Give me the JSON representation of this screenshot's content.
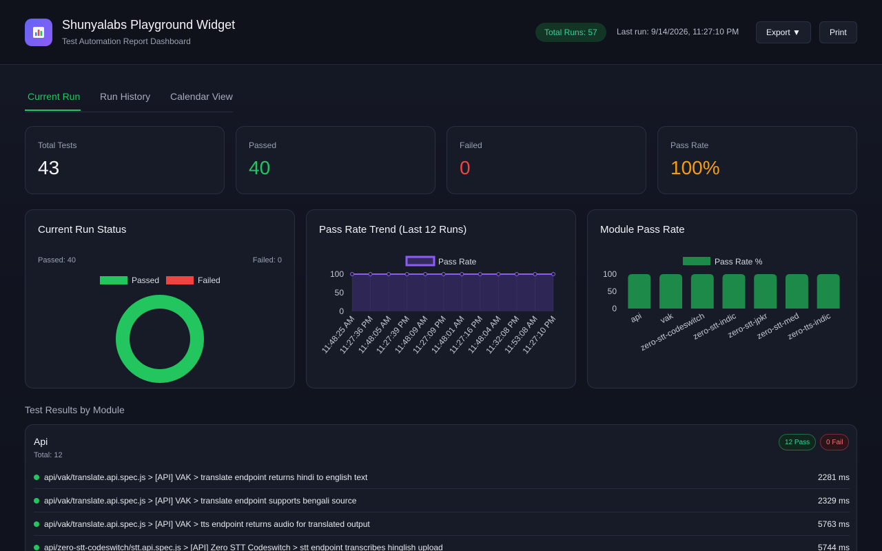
{
  "header": {
    "title": "Shunyalabs Playground Widget",
    "subtitle": "Test Automation Report Dashboard",
    "logo_icon": "bar-chart-icon",
    "total_runs": "Total Runs: 57",
    "last_run": "Last run: 9/14/2026, 11:27:10 PM",
    "export_label": "Export ▼",
    "print_label": "Print"
  },
  "tabs": [
    {
      "label": "Current Run",
      "active": true
    },
    {
      "label": "Run History",
      "active": false
    },
    {
      "label": "Calendar View",
      "active": false
    }
  ],
  "stats": [
    {
      "label": "Total Tests",
      "value": "43",
      "color": "#f3f4f8"
    },
    {
      "label": "Passed",
      "value": "40",
      "color": "#22c55e"
    },
    {
      "label": "Failed",
      "value": "0",
      "color": "#ef4444"
    },
    {
      "label": "Pass Rate",
      "value": "100%",
      "color": "#f59e0b"
    }
  ],
  "chart_data": [
    {
      "type": "pie",
      "title": "Current Run Status",
      "passed_label": "Passed: 40",
      "failed_label": "Failed: 0",
      "categories": [
        "Passed",
        "Failed"
      ],
      "values": [
        40,
        0
      ],
      "colors": [
        "#22c55e",
        "#ef4444"
      ],
      "legend": "top"
    },
    {
      "type": "area",
      "title": "Pass Rate Trend (Last 12 Runs)",
      "categories": [
        "11:48:25 AM",
        "11:27:36 PM",
        "11:48:05 AM",
        "11:27:39 PM",
        "11:48:09 AM",
        "11:27:09 PM",
        "11:48:01 AM",
        "11:27:16 PM",
        "11:48:04 AM",
        "11:32:08 PM",
        "11:53:08 AM",
        "11:27:10 PM"
      ],
      "series": [
        {
          "name": "Pass Rate",
          "values": [
            100,
            100,
            100,
            100,
            100,
            100,
            100,
            100,
            100,
            100,
            100,
            100
          ]
        }
      ],
      "yticks": [
        "100",
        "50",
        "0"
      ],
      "ylim": [
        0,
        100
      ],
      "color": "#8b5cf6",
      "legend": "top"
    },
    {
      "type": "bar",
      "title": "Module Pass Rate",
      "categories": [
        "api",
        "vak",
        "zero-stt-codeswitch",
        "zero-stt-indic",
        "zero-stt-jpkr",
        "zero-stt-med",
        "zero-tts-indic"
      ],
      "series": [
        {
          "name": "Pass Rate %",
          "values": [
            100,
            100,
            100,
            100,
            100,
            100,
            100
          ]
        }
      ],
      "yticks": [
        "100",
        "50",
        "0"
      ],
      "ylim": [
        0,
        100
      ],
      "color": "#1e8a4a",
      "legend": "top"
    }
  ],
  "section_title": "Test Results by Module",
  "module": {
    "name": "Api",
    "total": "Total: 12",
    "pass_badge": "12 Pass",
    "fail_badge": "0 Fail",
    "tests": [
      {
        "name": "api/vak/translate.api.spec.js > [API] VAK > translate endpoint returns hindi to english text",
        "time": "2281 ms"
      },
      {
        "name": "api/vak/translate.api.spec.js > [API] VAK > translate endpoint supports bengali source",
        "time": "2329 ms"
      },
      {
        "name": "api/vak/translate.api.spec.js > [API] VAK > tts endpoint returns audio for translated output",
        "time": "5763 ms"
      },
      {
        "name": "api/zero-stt-codeswitch/stt.api.spec.js > [API] Zero STT Codeswitch > stt endpoint transcribes hinglish upload",
        "time": "5744 ms"
      }
    ]
  }
}
